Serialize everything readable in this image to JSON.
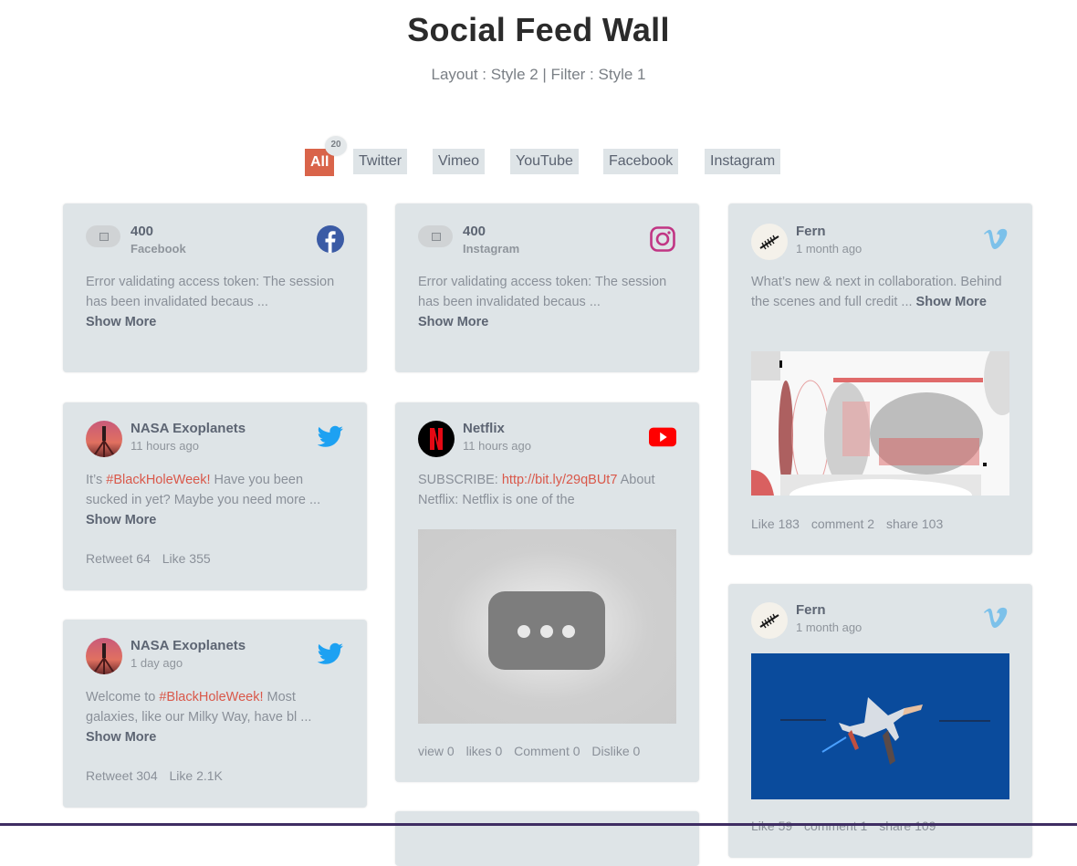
{
  "header": {
    "title": "Social Feed Wall",
    "subtitle": "Layout : Style 2 | Filter : Style 1"
  },
  "filters": {
    "items": [
      {
        "label": "All",
        "active": true
      },
      {
        "label": "Twitter"
      },
      {
        "label": "Vimeo"
      },
      {
        "label": "YouTube"
      },
      {
        "label": "Facebook"
      },
      {
        "label": "Instagram"
      }
    ],
    "all_count": "20"
  },
  "colors": {
    "accent": "#d9644a",
    "card_bg": "#dee4e7",
    "hashtag": "#d9584a",
    "facebook": "#3b5ba5",
    "instagram": "#c13584",
    "twitter": "#1da1f2",
    "youtube": "#ff0000",
    "vimeo": "#7cc1ea"
  },
  "posts": [
    {
      "network": "facebook",
      "network_icon": "facebook-icon",
      "name": "400",
      "sub": "Facebook",
      "text": "Error validating access token: The session has been invalidated becaus ...",
      "show_more": "Show More"
    },
    {
      "network": "instagram",
      "network_icon": "instagram-icon",
      "name": "400",
      "sub": "Instagram",
      "text": "Error validating access token: The session has been invalidated becaus ...",
      "show_more": "Show More"
    },
    {
      "network": "vimeo",
      "network_icon": "vimeo-icon",
      "name": "Fern",
      "sub": "1 month ago",
      "text": "What’s new & next in collaboration. Behind the scenes and full credit ...",
      "show_more": "Show More",
      "stats": [
        "Like 183",
        "comment 2",
        "share 103"
      ]
    },
    {
      "network": "twitter",
      "network_icon": "twitter-icon",
      "name": "NASA Exoplanets",
      "sub": "11 hours ago",
      "text_pre": "It’s ",
      "hashtag": "#BlackHoleWeek!",
      "text_post": " Have you been sucked in yet? Maybe you need more ...",
      "show_more": "Show More",
      "stats": [
        "Retweet 64",
        "Like 355"
      ]
    },
    {
      "network": "youtube",
      "network_icon": "youtube-icon",
      "name": "Netflix",
      "sub": "11 hours ago",
      "text_pre": "SUBSCRIBE: ",
      "link": "http://bit.ly/29qBUt7",
      "text_post": " About Netflix: Netflix is one of the",
      "stats": [
        "view 0",
        "likes 0",
        "Comment 0",
        "Dislike 0"
      ]
    },
    {
      "network": "twitter",
      "network_icon": "twitter-icon",
      "name": "NASA Exoplanets",
      "sub": "1 day ago",
      "text_pre": "Welcome to ",
      "hashtag": "#BlackHoleWeek!",
      "text_post": " Most galaxies, like our Milky Way, have bl ...",
      "show_more": "Show More",
      "stats": [
        "Retweet 304",
        "Like 2.1K"
      ]
    },
    {
      "network": "vimeo",
      "network_icon": "vimeo-icon",
      "name": "Fern",
      "sub": "1 month ago",
      "stats": [
        "Like 59",
        "comment 1",
        "share 109"
      ]
    }
  ]
}
